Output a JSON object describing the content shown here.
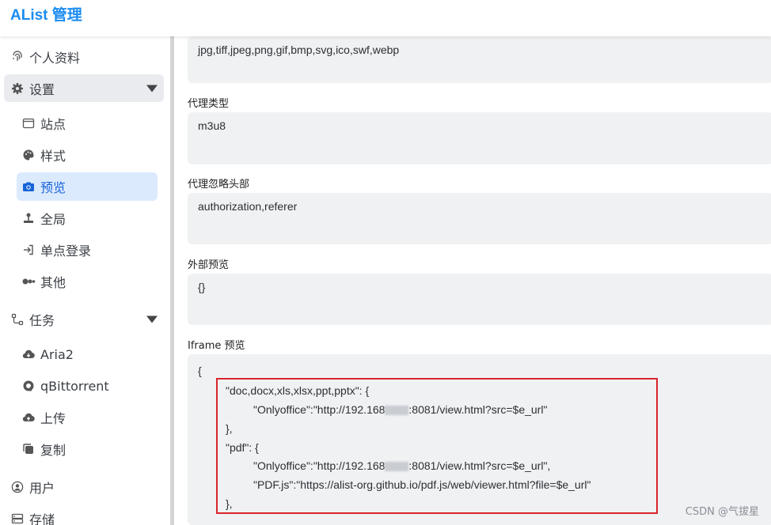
{
  "app": {
    "title": "AList 管理"
  },
  "sidebar": {
    "items": [
      {
        "label": "个人资料",
        "icon": "fingerprint-icon"
      },
      {
        "label": "设置",
        "icon": "gear-icon",
        "expanded": true
      },
      {
        "label": "站点",
        "icon": "window-icon"
      },
      {
        "label": "样式",
        "icon": "palette-icon"
      },
      {
        "label": "预览",
        "icon": "camera-icon",
        "active": true
      },
      {
        "label": "全局",
        "icon": "joystick-icon"
      },
      {
        "label": "单点登录",
        "icon": "login-icon"
      },
      {
        "label": "其他",
        "icon": "dots-icon"
      },
      {
        "label": "任务",
        "icon": "tasks-icon",
        "expanded": true
      },
      {
        "label": "Aria2",
        "icon": "cloud-download-icon"
      },
      {
        "label": "qBittorrent",
        "icon": "qbittorrent-icon"
      },
      {
        "label": "上传",
        "icon": "cloud-upload-icon"
      },
      {
        "label": "复制",
        "icon": "copy-icon"
      },
      {
        "label": "用户",
        "icon": "user-icon"
      },
      {
        "label": "存储",
        "icon": "storage-icon"
      }
    ]
  },
  "fields": {
    "image_types": {
      "value": "jpg,tiff,jpeg,png,gif,bmp,svg,ico,swf,webp"
    },
    "proxy_types": {
      "label": "代理类型",
      "value": "m3u8"
    },
    "proxy_ignore_headers": {
      "label": "代理忽略头部",
      "value": "authorization,referer"
    },
    "external_previews": {
      "label": "外部预览",
      "value": "{}"
    },
    "iframe_previews": {
      "label": "Iframe 预览",
      "lines": [
        "{",
        "\"doc,docx,xls,xlsx,ppt,pptx\": {",
        "\"Onlyoffice\":\"http://192.168",
        ":8081/view.html?src=$e_url\"",
        "},",
        "\"pdf\": {",
        "\"Onlyoffice\":\"http://192.168",
        ":8081/view.html?src=$e_url\",",
        "\"PDF.js\":\"https://alist-org.github.io/pdf.js/web/viewer.html?file=$e_url\"",
        "},"
      ]
    }
  },
  "watermark": "CSDN @气拔星",
  "colors": {
    "brand": "#1a8cf0",
    "active_bg": "#dceafe",
    "active_fg": "#1664d8",
    "highlight": "#d9252b",
    "field_bg": "#f0f1f3"
  }
}
